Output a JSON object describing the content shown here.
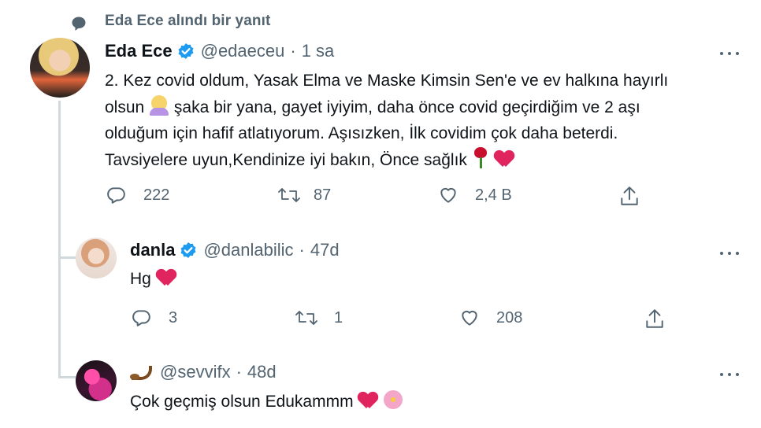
{
  "social_context": {
    "text": "Eda Ece alındı bir yanıt",
    "icon": "speech-bubble-icon"
  },
  "colors": {
    "accent": "#1d9bf0",
    "secondary_text": "#536471",
    "thread_line": "#cfd9de"
  },
  "main_tweet": {
    "name": "Eda Ece",
    "handle": "@edaeceu",
    "time": "1 sa",
    "text_lines": [
      "2. Kez covid oldum, Yasak Elma ve Maske Kimsin Sen'e ve ev halkına hayırlı",
      "olsun",
      "şaka bir yana, gayet iyiyim, daha önce covid geçirdiğim ve 2 aşı",
      "olduğum için hafif atlatıyorum. Aşısızken, İlk covidim çok daha beterdi.",
      "Tavsiyelere uyun,Kendinize iyi bakın, Önce sağlık"
    ],
    "actions": {
      "replies": "222",
      "retweets": "87",
      "likes": "2,4 B"
    }
  },
  "reply_1": {
    "name": "danla",
    "handle": "@danlabilic",
    "time": "47d",
    "text": "Hg",
    "actions": {
      "replies": "3",
      "retweets": "1",
      "likes": "208"
    }
  },
  "reply_2": {
    "handle": "@sevvifx",
    "time": "48d",
    "text": "Çok geçmiş olsun Edukammm"
  }
}
